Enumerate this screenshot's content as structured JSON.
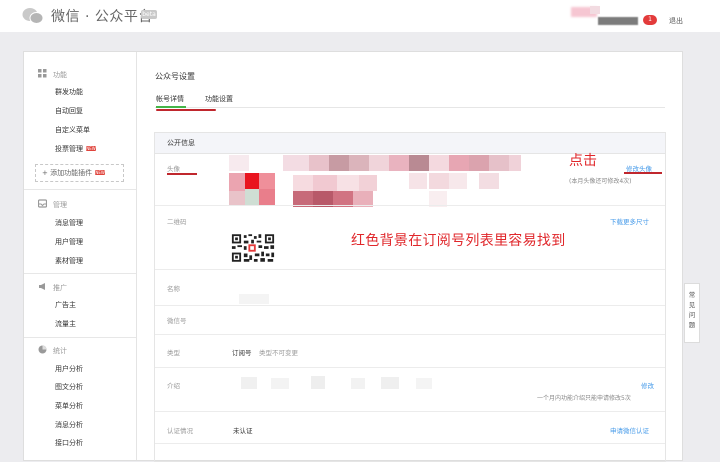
{
  "header": {
    "brand": "微信 · 公众平台",
    "beta_label": "beta",
    "badge_count": "1",
    "logout_label": "退出"
  },
  "sidebar": {
    "sections": [
      {
        "title": "功能",
        "icon": "grid-icon",
        "items": [
          "群发功能",
          "自动回复",
          "自定义菜单",
          "投票管理"
        ]
      },
      {
        "title": "管理",
        "icon": "inbox-icon",
        "items": [
          "消息管理",
          "用户管理",
          "素材管理"
        ]
      },
      {
        "title": "推广",
        "icon": "megaphone-icon",
        "items": [
          "广告主",
          "流量主"
        ]
      },
      {
        "title": "统计",
        "icon": "pie-chart-icon",
        "items": [
          "用户分析",
          "图文分析",
          "菜单分析",
          "消息分析",
          "接口分析"
        ]
      }
    ],
    "hot_label": "NEW",
    "add_plugin_label": "+ 添加功能插件"
  },
  "content": {
    "page_title": "公众号设置",
    "tabs": [
      "帐号详情",
      "功能设置"
    ],
    "panel_title": "公开信息",
    "rows": {
      "avatar": {
        "label": "头像",
        "link": "修改头像",
        "note": "(本月头像还可修改4次)"
      },
      "qrcode": {
        "label": "二维码",
        "link": "下载更多尺寸"
      },
      "name": {
        "label": "名称"
      },
      "wechat_id": {
        "label": "微信号"
      },
      "type": {
        "label": "类型",
        "value": "订阅号",
        "hint": "类型不可变更"
      },
      "intro": {
        "label": "介绍",
        "link": "修改",
        "note": "一个月内功能介绍只能申请修改5次"
      },
      "verify": {
        "label": "认证情况",
        "value": "未认证",
        "link": "申请微信认证"
      }
    }
  },
  "annotations": {
    "click": "点击",
    "tip": "红色背景在订阅号列表里容易找到"
  },
  "faq_label": "常见问题",
  "colors": {
    "accent_green": "#44b549",
    "link_blue": "#459ae9",
    "annotation_red": "#e0272b"
  }
}
